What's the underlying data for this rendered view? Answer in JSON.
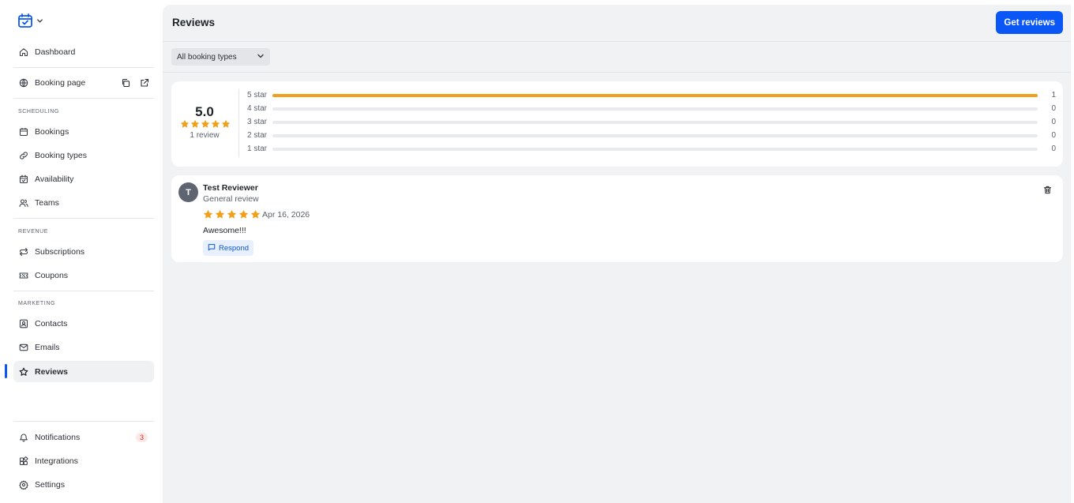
{
  "sidebar": {
    "top_items": [
      {
        "label": "Dashboard"
      },
      {
        "label": "Booking page"
      }
    ],
    "sections": [
      {
        "label": "SCHEDULING",
        "items": [
          {
            "label": "Bookings"
          },
          {
            "label": "Booking types"
          },
          {
            "label": "Availability"
          },
          {
            "label": "Teams"
          }
        ]
      },
      {
        "label": "REVENUE",
        "items": [
          {
            "label": "Subscriptions"
          },
          {
            "label": "Coupons"
          }
        ]
      },
      {
        "label": "MARKETING",
        "items": [
          {
            "label": "Contacts"
          },
          {
            "label": "Emails"
          },
          {
            "label": "Reviews"
          }
        ]
      }
    ],
    "bottom_items": [
      {
        "label": "Notifications",
        "badge": "3"
      },
      {
        "label": "Integrations"
      },
      {
        "label": "Settings"
      }
    ],
    "active_item": "Reviews"
  },
  "header": {
    "title": "Reviews",
    "get_reviews_label": "Get reviews"
  },
  "filter": {
    "selected": "All booking types"
  },
  "summary": {
    "average": "5.0",
    "count_text": "1 review",
    "distribution": [
      {
        "label": "5 star",
        "count": "1",
        "fraction": 1.0
      },
      {
        "label": "4 star",
        "count": "0",
        "fraction": 0
      },
      {
        "label": "3 star",
        "count": "0",
        "fraction": 0
      },
      {
        "label": "2 star",
        "count": "0",
        "fraction": 0
      },
      {
        "label": "1 star",
        "count": "0",
        "fraction": 0
      }
    ]
  },
  "reviews": [
    {
      "initial": "T",
      "name": "Test Reviewer",
      "type": "General review",
      "rating": 5,
      "date": "Apr 16, 2026",
      "text": "Awesome!!!",
      "respond_label": "Respond"
    }
  ],
  "colors": {
    "accent": "#0b57f5",
    "star": "#f0a01a",
    "badge_text": "#d93025"
  }
}
